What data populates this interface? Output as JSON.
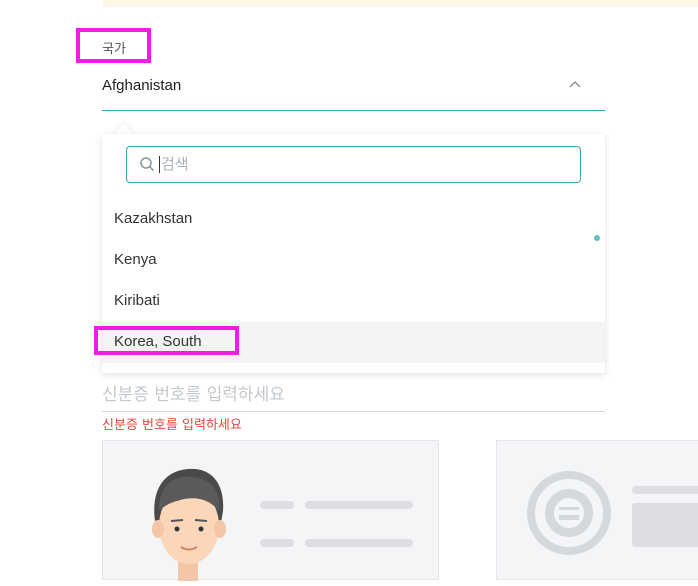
{
  "form": {
    "country_label": "국가",
    "selected_country": "Afghanistan",
    "search_placeholder": "검색",
    "options": [
      "Kazakhstan",
      "Kenya",
      "Kiribati",
      "Korea, South"
    ],
    "highlighted_option": "Korea, South",
    "id_placeholder": "신분증 번호를 입력하세요",
    "id_error": "신분증 번호를 입력하세요"
  },
  "colors": {
    "accent": "#2fa7a7",
    "highlight_box": "#ee1de7",
    "error": "#e8453c",
    "banner": "#fdf6e6"
  }
}
